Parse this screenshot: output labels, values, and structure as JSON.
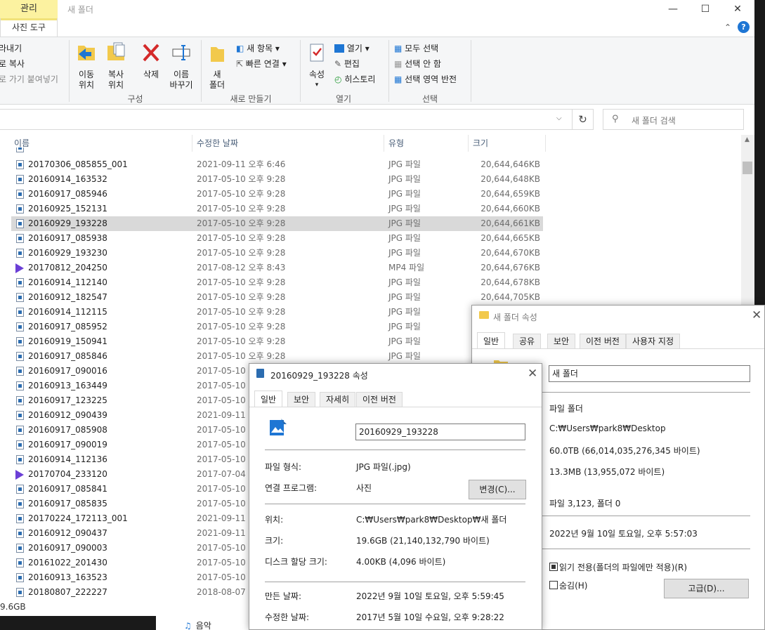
{
  "explorer": {
    "context_tab": "관리",
    "title": "새 폴더",
    "ribbon_tab": "사진 도구",
    "ribbon": {
      "clipboard_partial": [
        "라내기",
        "로 복사",
        "로 가기 붙여넣기"
      ],
      "move_to": "이동\n위치",
      "copy_to": "복사\n위치",
      "delete": "삭제",
      "rename": "이름\n바꾸기",
      "organize_label": "구성",
      "new_folder": "새\n폴더",
      "new_item": "새 항목",
      "easy_access": "빠른 연결",
      "new_label": "새로 만들기",
      "properties": "속성",
      "open": "열기",
      "edit": "편집",
      "history": "히스토리",
      "open_label": "열기",
      "select_all": "모두 선택",
      "select_none": "선택 안 함",
      "invert_selection": "선택 영역 반전",
      "select_label": "선택"
    },
    "search_placeholder": "새 폴더 검색",
    "columns": {
      "name": "이름",
      "date": "수정한 날짜",
      "type": "유형",
      "size": "크기"
    },
    "files": [
      {
        "name": "20170306_085855_001",
        "date": "2021-09-11 오후 6:46",
        "type": "JPG 파일",
        "size": "20,644,646KB",
        "icon": "image",
        "selected": false
      },
      {
        "name": "20160914_163532",
        "date": "2017-05-10 오후 9:28",
        "type": "JPG 파일",
        "size": "20,644,648KB",
        "icon": "image",
        "selected": false
      },
      {
        "name": "20160917_085946",
        "date": "2017-05-10 오후 9:28",
        "type": "JPG 파일",
        "size": "20,644,659KB",
        "icon": "image",
        "selected": false
      },
      {
        "name": "20160925_152131",
        "date": "2017-05-10 오후 9:28",
        "type": "JPG 파일",
        "size": "20,644,660KB",
        "icon": "image",
        "selected": false
      },
      {
        "name": "20160929_193228",
        "date": "2017-05-10 오후 9:28",
        "type": "JPG 파일",
        "size": "20,644,661KB",
        "icon": "image",
        "selected": true
      },
      {
        "name": "20160917_085938",
        "date": "2017-05-10 오후 9:28",
        "type": "JPG 파일",
        "size": "20,644,665KB",
        "icon": "image",
        "selected": false
      },
      {
        "name": "20160929_193230",
        "date": "2017-05-10 오후 9:28",
        "type": "JPG 파일",
        "size": "20,644,670KB",
        "icon": "image",
        "selected": false
      },
      {
        "name": "20170812_204250",
        "date": "2017-08-12 오후 8:43",
        "type": "MP4 파일",
        "size": "20,644,676KB",
        "icon": "video",
        "selected": false
      },
      {
        "name": "20160914_112140",
        "date": "2017-05-10 오후 9:28",
        "type": "JPG 파일",
        "size": "20,644,678KB",
        "icon": "image",
        "selected": false
      },
      {
        "name": "20160912_182547",
        "date": "2017-05-10 오후 9:28",
        "type": "JPG 파일",
        "size": "20,644,705KB",
        "icon": "image",
        "selected": false
      },
      {
        "name": "20160914_112115",
        "date": "2017-05-10 오후 9:28",
        "type": "JPG 파일",
        "size": "",
        "icon": "image",
        "selected": false
      },
      {
        "name": "20160917_085952",
        "date": "2017-05-10 오후 9:28",
        "type": "JPG 파일",
        "size": "",
        "icon": "image",
        "selected": false
      },
      {
        "name": "20160919_150941",
        "date": "2017-05-10 오후 9:28",
        "type": "JPG 파일",
        "size": "",
        "icon": "image",
        "selected": false
      },
      {
        "name": "20160917_085846",
        "date": "2017-05-10 오후 9:28",
        "type": "JPG 파일",
        "size": "",
        "icon": "image",
        "selected": false
      },
      {
        "name": "20160917_090016",
        "date": "2017-05-10",
        "type": "",
        "size": "",
        "icon": "image",
        "selected": false
      },
      {
        "name": "20160913_163449",
        "date": "2017-05-10",
        "type": "",
        "size": "",
        "icon": "image",
        "selected": false
      },
      {
        "name": "20160917_123225",
        "date": "2017-05-10",
        "type": "",
        "size": "",
        "icon": "image",
        "selected": false
      },
      {
        "name": "20160912_090439",
        "date": "2021-09-11",
        "type": "",
        "size": "",
        "icon": "image",
        "selected": false
      },
      {
        "name": "20160917_085908",
        "date": "2017-05-10",
        "type": "",
        "size": "",
        "icon": "image",
        "selected": false
      },
      {
        "name": "20160917_090019",
        "date": "2017-05-10",
        "type": "",
        "size": "",
        "icon": "image",
        "selected": false
      },
      {
        "name": "20160914_112136",
        "date": "2017-05-10",
        "type": "",
        "size": "",
        "icon": "image",
        "selected": false
      },
      {
        "name": "20170704_233120",
        "date": "2017-07-04",
        "type": "",
        "size": "",
        "icon": "video",
        "selected": false
      },
      {
        "name": "20160917_085841",
        "date": "2017-05-10",
        "type": "",
        "size": "",
        "icon": "image",
        "selected": false
      },
      {
        "name": "20160917_085835",
        "date": "2017-05-10",
        "type": "",
        "size": "",
        "icon": "image",
        "selected": false
      },
      {
        "name": "20170224_172113_001",
        "date": "2021-09-11",
        "type": "",
        "size": "",
        "icon": "image",
        "selected": false
      },
      {
        "name": "20160912_090437",
        "date": "2021-09-11",
        "type": "",
        "size": "",
        "icon": "image",
        "selected": false
      },
      {
        "name": "20160917_090003",
        "date": "2017-05-10",
        "type": "",
        "size": "",
        "icon": "image",
        "selected": false
      },
      {
        "name": "20161022_201430",
        "date": "2017-05-10",
        "type": "",
        "size": "",
        "icon": "image",
        "selected": false
      },
      {
        "name": "20160913_163523",
        "date": "2017-05-10",
        "type": "",
        "size": "",
        "icon": "image",
        "selected": false
      },
      {
        "name": "20180807_222227",
        "date": "2018-08-07",
        "type": "",
        "size": "",
        "icon": "image",
        "selected": false
      }
    ],
    "status": "9.6GB",
    "background_item": "음악"
  },
  "folder_props": {
    "title": "새 폴더 속성",
    "tabs": [
      "일반",
      "공유",
      "보안",
      "이전 버전",
      "사용자 지정"
    ],
    "name": "새 폴더",
    "type": "파일 폴더",
    "location": "C:₩Users₩park8₩Desktop",
    "size": "60.0TB (66,014,035,276,345 바이트)",
    "size_on_disk": "13.3MB (13,955,072 바이트)",
    "contains": "파일 3,123, 폴더 0",
    "created": "2022년 9월 10일 토요일, 오후 5:57:03",
    "readonly_label": "읽기 전용(폴더의 파일에만 적용)(R)",
    "hidden_label": "숨김(H)",
    "advanced_button": "고급(D)..."
  },
  "file_props": {
    "title": "20160929_193228 속성",
    "tabs": [
      "일반",
      "보안",
      "자세히",
      "이전 버전"
    ],
    "name": "20160929_193228",
    "type_label": "파일 형식:",
    "type_value": "JPG 파일(.jpg)",
    "opens_with_label": "연결 프로그램:",
    "opens_with_value": "사진",
    "change_button": "변경(C)...",
    "location_label": "위치:",
    "location_value": "C:₩Users₩park8₩Desktop₩새 폴더",
    "size_label": "크기:",
    "size_value": "19.6GB (21,140,132,790 바이트)",
    "size_on_disk_label": "디스크 할당 크기:",
    "size_on_disk_value": "4.00KB (4,096 바이트)",
    "created_label": "만든 날짜:",
    "created_value": "2022년 9월 10일 토요일, 오후 5:59:45",
    "modified_label": "수정한 날짜:",
    "modified_value": "2017년 5월 10일 수요일, 오후 9:28:22"
  },
  "colors": {
    "context_tab": "#fcf2a0",
    "selection": "#d9d9d9",
    "accent": "#1e76d4",
    "video_icon": "#6b3fd6"
  }
}
